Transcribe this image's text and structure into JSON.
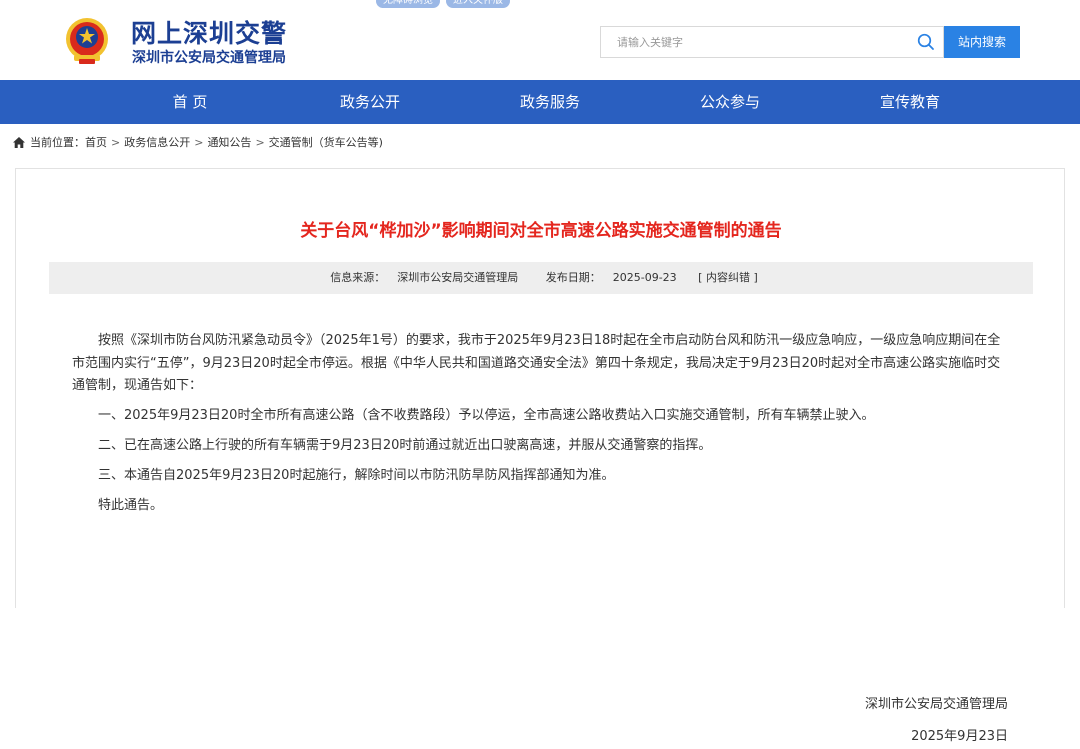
{
  "header": {
    "top_links": [
      "无障碍浏览",
      "进入关怀版"
    ],
    "site_title": "网上深圳交警",
    "site_subtitle": "深圳市公安局交通管理局",
    "search_placeholder": "请输入关键字",
    "search_button": "站内搜索"
  },
  "nav": {
    "items": [
      "首 页",
      "政务公开",
      "政务服务",
      "公众参与",
      "宣传教育"
    ]
  },
  "breadcrumb": {
    "prefix": "当前位置：",
    "items": [
      "首页",
      "政务信息公开",
      "通知公告",
      "交通管制（货车公告等)"
    ],
    "separator": ">"
  },
  "article": {
    "title": "关于台风“桦加沙”影响期间对全市高速公路实施交通管制的通告",
    "source_label": "信息来源：",
    "source": "深圳市公安局交通管理局",
    "date_label": "发布日期：",
    "date": "2025-09-23",
    "correction": "[ 内容纠错 ]",
    "paragraphs": [
      "按照《深圳市防台风防汛紧急动员令》（2025年1号）的要求，我市于2025年9月23日18时起在全市启动防台风和防汛一级应急响应，一级应急响应期间在全市范围内实行“五停”，9月23日20时起全市停运。根据《中华人民共和国道路交通安全法》第四十条规定，我局决定于9月23日20时起对全市高速公路实施临时交通管制，现通告如下：",
      "一、2025年9月23日20时全市所有高速公路（含不收费路段）予以停运，全市高速公路收费站入口实施交通管制，所有车辆禁止驶入。",
      "二、已在高速公路上行驶的所有车辆需于9月23日20时前通过就近出口驶离高速，并服从交通警察的指挥。",
      "三、本通告自2025年9月23日20时起施行，解除时间以市防汛防旱防风指挥部通知为准。",
      "特此通告。"
    ],
    "signature_org": "深圳市公安局交通管理局",
    "signature_date": "2025年9月23日"
  },
  "colors": {
    "brand_blue": "#1c3f93",
    "nav_blue": "#2a5fc0",
    "button_blue": "#2a82e4",
    "title_red": "#e4261e"
  },
  "icons": [
    "police-emblem-icon",
    "search-icon",
    "home-icon"
  ]
}
